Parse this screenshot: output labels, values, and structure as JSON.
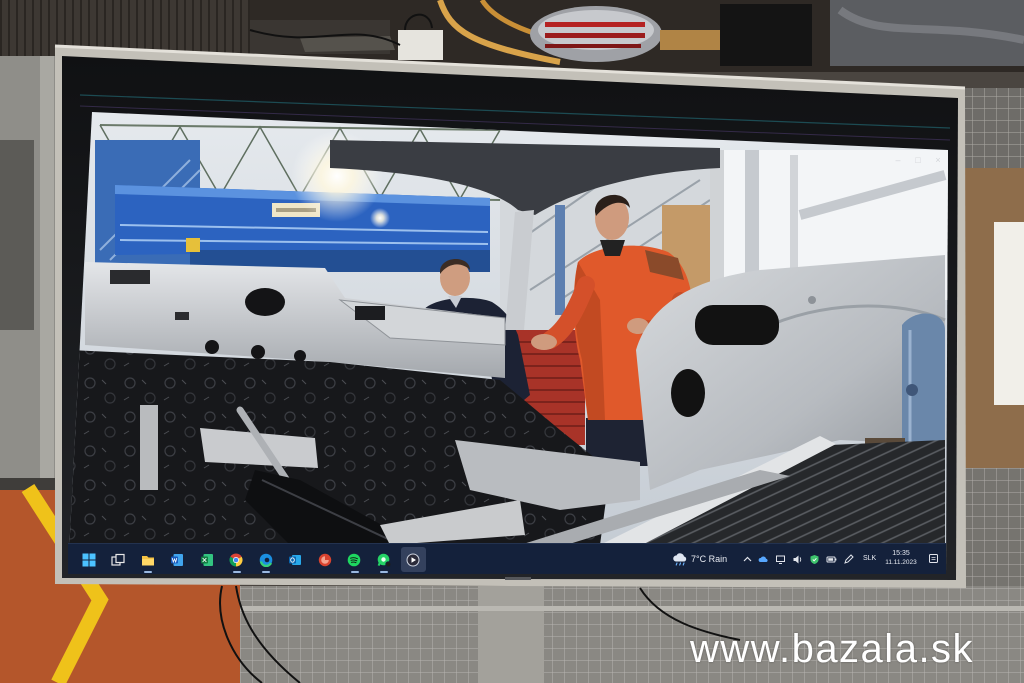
{
  "photo": {
    "watermark": "www.bazala.sk"
  },
  "screen": {
    "window_controls": {
      "minimize": "–",
      "maximize": "□",
      "close": "×"
    },
    "taskbar": {
      "pinned_apps": [
        {
          "icon": "windows-start-icon"
        },
        {
          "icon": "task-view-icon"
        },
        {
          "icon": "file-explorer-icon",
          "running": true
        },
        {
          "icon": "word-icon"
        },
        {
          "icon": "excel-icon"
        },
        {
          "icon": "chrome-icon",
          "running": true
        },
        {
          "icon": "edge-icon",
          "running": true
        },
        {
          "icon": "outlook-icon"
        },
        {
          "icon": "red-app-icon"
        },
        {
          "icon": "spotify-icon",
          "running": true
        },
        {
          "icon": "chat-app-icon",
          "running": true
        },
        {
          "icon": "media-player-icon",
          "running": true,
          "active": true
        }
      ],
      "weather_icon": "rain-cloud-icon",
      "weather": "7°C Rain",
      "tray_icons": [
        "chevron-up-icon",
        "onedrive-icon",
        "network-icon",
        "speaker-icon",
        "defender-shield-icon",
        "battery-icon",
        "pen-icon"
      ],
      "language": "SLK",
      "time": "15:35",
      "date": "11.11.2023",
      "notification_icon": "notification-icon"
    }
  },
  "colors": {
    "taskbar": "#14213b",
    "windows_accent": "#4cc2ff",
    "crane_blue": "#2e66c2",
    "jacket_orange": "#e0592b",
    "floor_line_yellow": "#f0c419",
    "watermark": "#ffffff"
  }
}
